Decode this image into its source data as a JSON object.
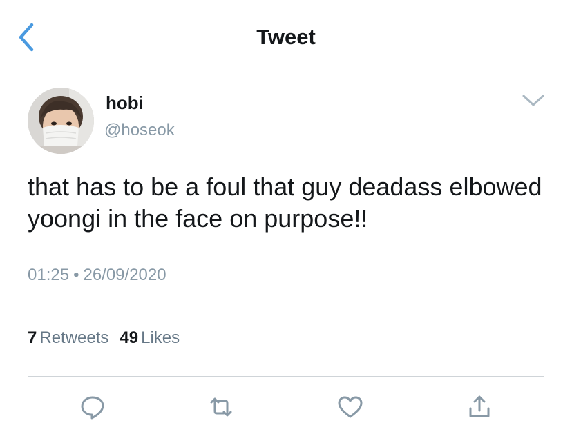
{
  "header": {
    "title": "Tweet",
    "back_icon": "chevron-left-icon",
    "accent_color": "#4a9ae0"
  },
  "author": {
    "display_name": "hobi",
    "handle": "@hoseok",
    "avatar_icon": "avatar-photo"
  },
  "tweet": {
    "text": "that has to be a foul that guy deadass elbowed yoongi in the face on purpose!!",
    "time": "01:25",
    "separator": "•",
    "date": "26/09/2020"
  },
  "stats": {
    "retweets_count": "7",
    "retweets_label": "Retweets",
    "likes_count": "49",
    "likes_label": "Likes"
  },
  "actions": [
    {
      "icon": "reply-icon"
    },
    {
      "icon": "retweet-icon"
    },
    {
      "icon": "like-icon"
    },
    {
      "icon": "share-icon"
    }
  ],
  "colors": {
    "text": "#14171a",
    "secondary": "#8899a6",
    "divider": "#cfd4d8",
    "icon": "#8899a6"
  }
}
